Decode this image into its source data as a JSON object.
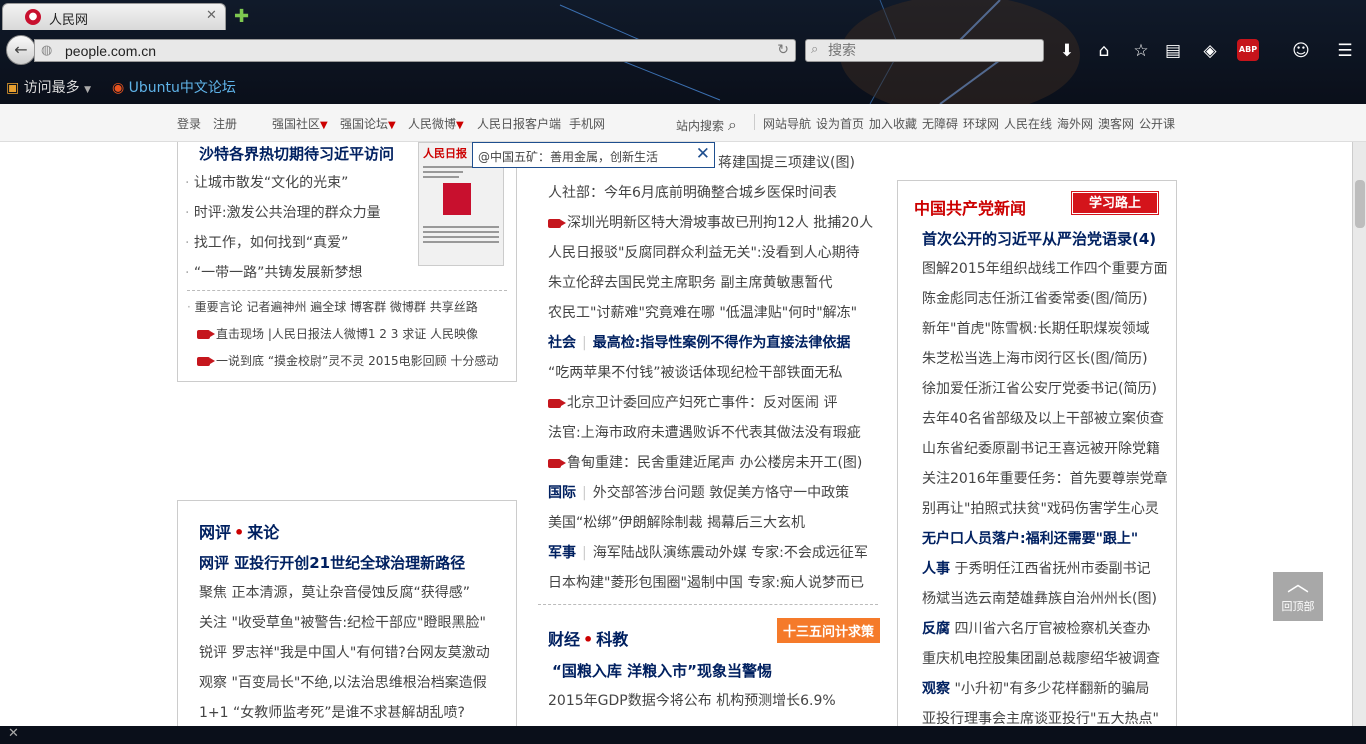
{
  "browser": {
    "tab_title": "人民网",
    "url": "people.com.cn",
    "search_placeholder": "搜索",
    "bookmarks": [
      "访问最多",
      "Ubuntu中文论坛"
    ]
  },
  "sitenav": {
    "left": [
      "登录",
      "注册",
      "强国社区",
      "强国论坛",
      "人民微博",
      "人民日报客户端",
      "手机网"
    ],
    "search_label": "站内搜索",
    "right": [
      "网站导航",
      "设为首页",
      "加入收藏",
      "无障碍",
      "环球网",
      "人民在线",
      "海外网",
      "澳客网",
      "公开课"
    ]
  },
  "tooltip": "@中国五矿：善用金属，创新生活",
  "left_col": {
    "headline": "沙特各界热切期待习近平访问",
    "items": [
      "让城市散发“文化的光束”",
      "时评:激发公共治理的群众力量",
      "找工作，如何找到“真爱”",
      "“一带一路”共铸发展新梦想"
    ],
    "newspaper_masthead": "人民日报",
    "links_row1": "重要言论  记者遍神州  遍全球  博客群  微博群  共享丝路",
    "links_row2": "直击现场  |人民日报法人微博1  2  3  求证  人民映像",
    "links_row3": "一说到底 “摸金校尉”灵不灵  2015电影回顾  十分感动"
  },
  "comment_box": {
    "title1": "网评",
    "title2": "来论",
    "headline": "网评 亚投行开创21世纪全球治理新路径",
    "items": [
      "聚焦 正本清源，莫让杂音侵蚀反腐“获得感”",
      "关注 \"收受草鱼\"被警告:纪检干部应\"瞪眼黑脸\"",
      "锐评 罗志祥\"我是中国人\"有何错?台网友莫激动",
      "观察 \"百变局长\"不绝,以法治思维根治档案造假",
      "1+1 “女教师监考死”是谁不求甚解胡乱喷?"
    ]
  },
  "mid_col": {
    "items": [
      {
        "text": "蒋建国提三项建议(图)",
        "cam": false
      },
      {
        "text": "人社部：今年6月底前明确整合城乡医保时间表",
        "cam": false
      },
      {
        "text": "深圳光明新区特大滑坡事故已刑拘12人 批捕20人",
        "cam": true
      },
      {
        "text": "人民日报驳\"反腐同群众利益无关\":没看到人心期待",
        "cam": false
      },
      {
        "text": "朱立伦辞去国民党主席职务 副主席黄敏惠暂代",
        "cam": false
      },
      {
        "text": "农民工\"讨薪难\"究竟难在哪 \"低温津贴\"何时\"解冻\"",
        "cam": false
      }
    ],
    "society_label": "社会",
    "society_headline": "最高检:指导性案例不得作为直接法律依据",
    "items2": [
      {
        "text": "“吃两苹果不付钱”被谈话体现纪检干部铁面无私",
        "cam": false
      },
      {
        "text": "北京卫计委回应产妇死亡事件：反对医闹 评",
        "cam": true
      },
      {
        "text": "法官:上海市政府未遭遇败诉不代表其做法没有瑕疵",
        "cam": false
      },
      {
        "text": "鲁甸重建：民舍重建近尾声 办公楼房未开工(图)",
        "cam": true
      }
    ],
    "intl_label": "国际",
    "intl_text": "外交部答涉台问题 敦促美方恪守一中政策",
    "intl_item": "美国“松绑”伊朗解除制裁 揭幕后三大玄机",
    "mil_label": "军事",
    "mil_text": "海军陆战队演练震动外媒 专家:不会成远征军",
    "mil_item": "日本构建\"菱形包围圈\"遏制中国 专家:痴人说梦而已",
    "finance_title1": "财经",
    "finance_title2": "科教",
    "finance_tag": "十三五问计求策",
    "finance_headline": "“国粮入库 洋粮入市”现象当警惕",
    "finance_item": "2015年GDP数据今将公布 机构预测增长6.9%"
  },
  "right_col": {
    "title": "中国共产党新闻",
    "ribbon": "学习路上",
    "headline": "首次公开的习近平从严治党语录(4)",
    "items": [
      "图解2015年组织战线工作四个重要方面",
      "陈金彪同志任浙江省委常委(图/简历)",
      "新年\"首虎\"陈雪枫:长期任职煤炭领域",
      "朱芝松当选上海市闵行区长(图/简历)",
      "徐加爱任浙江省公安厅党委书记(简历)",
      "去年40名省部级及以上干部被立案侦查",
      "山东省纪委原副书记王喜远被开除党籍",
      "关注2016年重要任务：首先要尊崇党章",
      "别再让\"拍照式扶贫\"戏码伤害学生心灵"
    ],
    "headline2": "无户口人员落户:福利还需要\"跟上\"",
    "personnel_label": "人事",
    "personnel_text": "于秀明任江西省抚州市委副书记",
    "item_p2": "杨斌当选云南楚雄彝族自治州州长(图)",
    "anticorrupt_label": "反腐",
    "anticorrupt_text": "四川省六名厅官被检察机关查办",
    "item_a2": "重庆机电控股集团副总裁廖绍华被调查",
    "observe_label": "观察",
    "observe_text": "\"小升初\"有多少花样翻新的骗局",
    "item_o2": "亚投行理事会主席谈亚投行\"五大热点\""
  },
  "back_to_top": "回顶部"
}
